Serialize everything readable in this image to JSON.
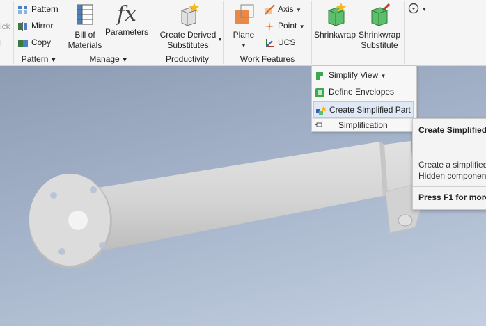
{
  "ribbon": {
    "partial_left_top": "ick",
    "partial_left_bottom": "l",
    "pattern_panel": {
      "pattern_label": "Pattern",
      "mirror_label": "Mirror",
      "copy_label": "Copy",
      "panel_label": "Pattern"
    },
    "manage_panel": {
      "bom_label_1": "Bill of",
      "bom_label_2": "Materials",
      "parameters_label": "Parameters",
      "panel_label": "Manage"
    },
    "productivity_panel": {
      "derived_label_1": "Create Derived",
      "derived_label_2": "Substitutes",
      "panel_label": "Productivity"
    },
    "work_features_panel": {
      "plane_label": "Plane",
      "axis_label": "Axis",
      "point_label": "Point",
      "ucs_label": "UCS",
      "panel_label": "Work Features"
    },
    "simplification_panel": {
      "shrinkwrap_label": "Shrinkwrap",
      "shrinkwrap_sub_label_1": "Shrinkwrap",
      "shrinkwrap_sub_label_2": "Substitute"
    }
  },
  "dropdown": {
    "items": [
      {
        "label": "Simplify View"
      },
      {
        "label": "Define Envelopes"
      },
      {
        "label": "Create Simplified Part"
      }
    ],
    "footer_label": "Simplification"
  },
  "tooltip": {
    "title": "Create Simplified",
    "desc_line_1": "Create a simplified",
    "desc_line_2": "Hidden componen",
    "help": "Press F1 for more"
  },
  "colors": {
    "ribbon_bg": "#f5f5f5",
    "viewport_top": "#8e9cb3",
    "viewport_bottom": "#c3cfe1",
    "highlight": "#dfe8f5",
    "part_gray": "#d8d8d8"
  }
}
